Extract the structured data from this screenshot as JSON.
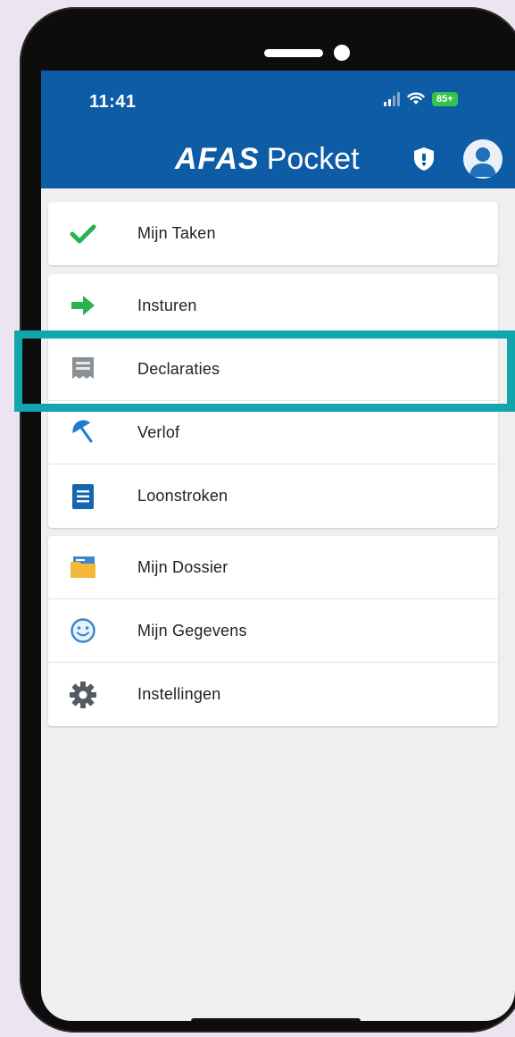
{
  "status_bar": {
    "time": "11:41",
    "battery": "85+"
  },
  "header": {
    "brand_bold": "AFAS",
    "brand_light": "Pocket",
    "color": "#0e5ba6"
  },
  "menu_groups": [
    {
      "items": [
        {
          "label": "Mijn Taken",
          "icon": "checkmark-icon"
        }
      ]
    },
    {
      "items": [
        {
          "label": "Insturen",
          "icon": "arrow-right-icon"
        },
        {
          "label": "Declaraties",
          "icon": "receipt-icon"
        },
        {
          "label": "Verlof",
          "icon": "beach-umbrella-icon"
        },
        {
          "label": "Loonstroken",
          "icon": "document-lines-icon"
        }
      ]
    },
    {
      "items": [
        {
          "label": "Mijn Dossier",
          "icon": "folder-icon"
        },
        {
          "label": "Mijn Gegevens",
          "icon": "smiley-icon"
        },
        {
          "label": "Instellingen",
          "icon": "gear-icon"
        }
      ]
    }
  ],
  "highlight_color": "#11a6ad"
}
